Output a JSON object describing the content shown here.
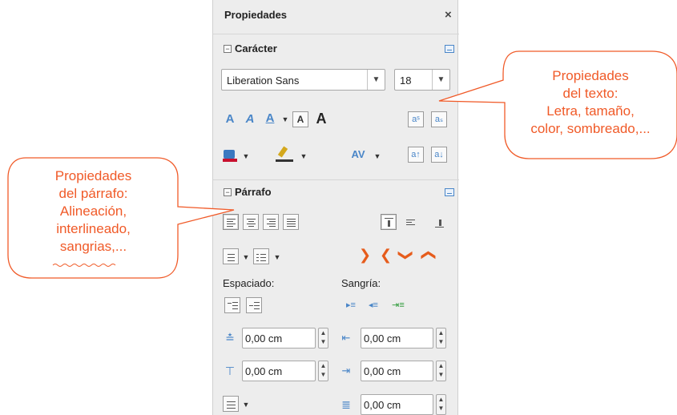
{
  "panel": {
    "title": "Propiedades",
    "close_symbol": "×",
    "character": {
      "header": "Carácter",
      "font_name": "Liberation Sans",
      "font_size": "18",
      "icons": [
        "outline-icon",
        "shadow-icon",
        "underline-icon",
        "strikethrough-icon",
        "bold-contour-icon",
        "superscript-icon",
        "subscript-icon",
        "highlight-color-icon",
        "font-color-icon",
        "character-spacing-icon",
        "increase-size-icon",
        "decrease-size-icon"
      ]
    },
    "paragraph": {
      "header": "Párrafo",
      "spacing_label": "Espaciado:",
      "indent_label": "Sangría:",
      "above_spacing": "0,00 cm",
      "below_spacing": "0,00 cm",
      "before_indent": "0,00 cm",
      "after_indent": "0,00 cm",
      "first_line_indent": "0,00 cm",
      "icons": [
        "align-left-icon",
        "align-center-icon",
        "align-right-icon",
        "justify-icon",
        "valign-top-icon",
        "valign-center-icon",
        "valign-bottom-icon",
        "bullets-icon",
        "numbering-icon",
        "increase-indent-icon",
        "decrease-indent-icon",
        "move-down-icon",
        "move-up-icon"
      ]
    }
  },
  "callouts": {
    "text_props": {
      "line1": "Propiedades",
      "line2": "del texto:",
      "line3": "Letra, tamaño,",
      "line4": "color, sombreado,..."
    },
    "paragraph_props": {
      "line1": "Propiedades",
      "line2": "del párrafo:",
      "line3": "Alineación,",
      "line4": "interlineado,",
      "line5": "sangrias,..."
    }
  },
  "colors": {
    "callout_stroke": "#f05a28",
    "callout_text": "#f05a28",
    "accent_blue": "#4a86c8",
    "chevron_orange": "#e65c1c",
    "panel_bg": "#ededed"
  }
}
